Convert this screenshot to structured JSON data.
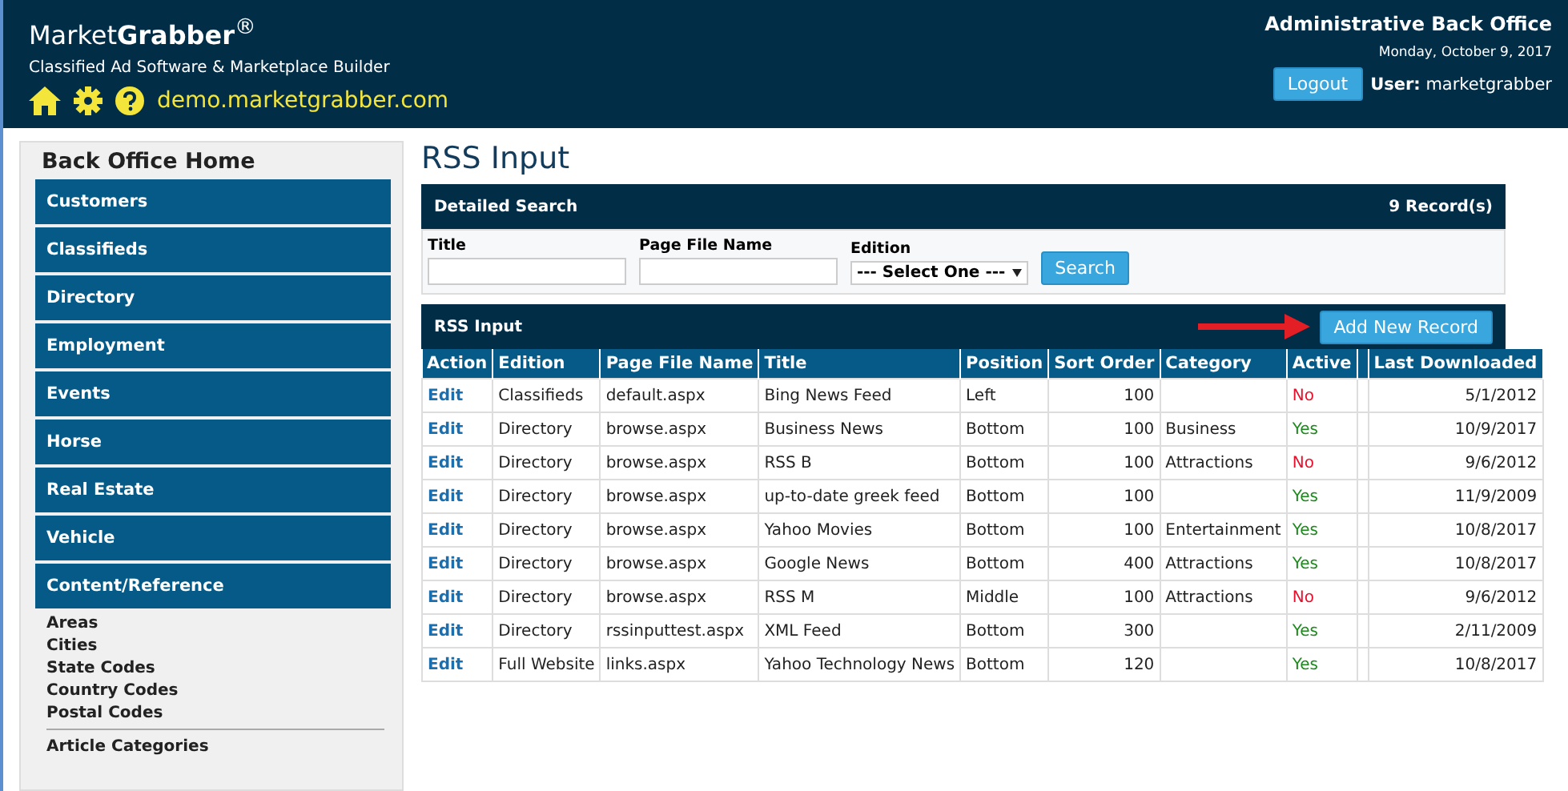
{
  "header": {
    "brand_light": "Market",
    "brand_bold": "Grabber",
    "brand_mark": "®",
    "tagline": "Classified Ad Software & Marketplace Builder",
    "site_link": "demo.marketgrabber.com",
    "office_title": "Administrative Back Office",
    "date": "Monday, October 9, 2017",
    "logout": "Logout",
    "user_label": "User:",
    "user_name": "marketgrabber"
  },
  "sidebar": {
    "title": "Back Office Home",
    "sections": [
      "Customers",
      "Classifieds",
      "Directory",
      "Employment",
      "Events",
      "Horse",
      "Real Estate",
      "Vehicle",
      "Content/Reference"
    ],
    "links": [
      "Areas",
      "Cities",
      "State Codes",
      "Country Codes",
      "Postal Codes"
    ],
    "links_2": [
      "Article Categories"
    ]
  },
  "page_title": "RSS Input",
  "search": {
    "title": "Detailed Search",
    "count": "9 Record(s)",
    "fields": [
      {
        "label": "Title"
      },
      {
        "label": "Page File Name"
      }
    ],
    "edition_label": "Edition",
    "edition_value": "--- Select One ---",
    "button": "Search"
  },
  "table": {
    "title": "RSS Input",
    "add_button": "Add New Record",
    "columns": [
      "Action",
      "Edition",
      "Page File Name",
      "Title",
      "Position",
      "Sort Order",
      "Category",
      "Active",
      "Last Downloaded"
    ],
    "rows": [
      {
        "action": "Edit",
        "edition": "Classifieds",
        "page": "default.aspx",
        "title": "Bing News Feed",
        "position": "Left",
        "sort": "100",
        "category": "",
        "active": "No",
        "active_on": false,
        "last": "5/1/2012"
      },
      {
        "action": "Edit",
        "edition": "Directory",
        "page": "browse.aspx",
        "title": "Business News",
        "position": "Bottom",
        "sort": "100",
        "category": "Business",
        "active": "Yes",
        "active_on": true,
        "last": "10/9/2017"
      },
      {
        "action": "Edit",
        "edition": "Directory",
        "page": "browse.aspx",
        "title": "RSS B",
        "position": "Bottom",
        "sort": "100",
        "category": "Attractions",
        "active": "No",
        "active_on": false,
        "last": "9/6/2012"
      },
      {
        "action": "Edit",
        "edition": "Directory",
        "page": "browse.aspx",
        "title": "up-to-date greek feed",
        "position": "Bottom",
        "sort": "100",
        "category": "",
        "active": "Yes",
        "active_on": true,
        "last": "11/9/2009"
      },
      {
        "action": "Edit",
        "edition": "Directory",
        "page": "browse.aspx",
        "title": "Yahoo Movies",
        "position": "Bottom",
        "sort": "100",
        "category": "Entertainment",
        "active": "Yes",
        "active_on": true,
        "last": "10/8/2017"
      },
      {
        "action": "Edit",
        "edition": "Directory",
        "page": "browse.aspx",
        "title": "Google News",
        "position": "Bottom",
        "sort": "400",
        "category": "Attractions",
        "active": "Yes",
        "active_on": true,
        "last": "10/8/2017"
      },
      {
        "action": "Edit",
        "edition": "Directory",
        "page": "browse.aspx",
        "title": "RSS M",
        "position": "Middle",
        "sort": "100",
        "category": "Attractions",
        "active": "No",
        "active_on": false,
        "last": "9/6/2012"
      },
      {
        "action": "Edit",
        "edition": "Directory",
        "page": "rssinputtest.aspx",
        "title": "XML Feed",
        "position": "Bottom",
        "sort": "300",
        "category": "",
        "active": "Yes",
        "active_on": true,
        "last": "2/11/2009"
      },
      {
        "action": "Edit",
        "edition": "Full Website",
        "page": "links.aspx",
        "title": "Yahoo Technology News",
        "position": "Bottom",
        "sort": "120",
        "category": "",
        "active": "Yes",
        "active_on": true,
        "last": "10/8/2017"
      }
    ]
  }
}
